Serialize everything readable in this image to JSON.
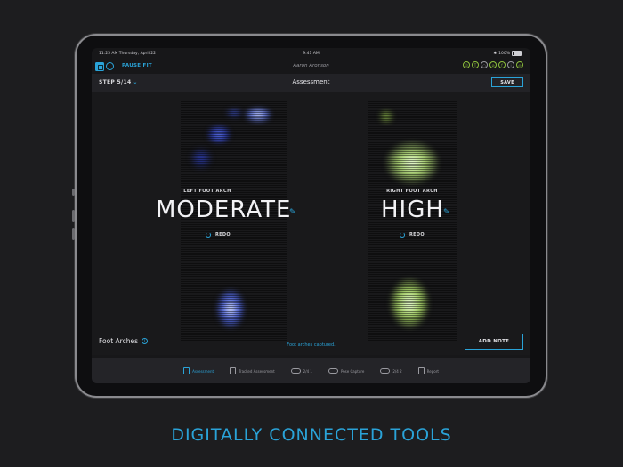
{
  "status_bar": {
    "time_date": "11:25 AM   Thursday, April 22",
    "center_time": "9:41 AM",
    "battery": "100%"
  },
  "top_bar": {
    "pause_label": "PAUSE FIT",
    "athlete_name": "Aaron Aronson",
    "tool_icons": [
      "tool-1",
      "tool-2",
      "tool-3",
      "tool-4",
      "tool-5",
      "tool-6",
      "tool-7"
    ]
  },
  "header": {
    "step_label": "STEP 5/14",
    "title": "Assessment",
    "save_label": "SAVE"
  },
  "left_foot": {
    "label": "LEFT FOOT ARCH",
    "value": "MODERATE",
    "redo_label": "REDO"
  },
  "right_foot": {
    "label": "RIGHT FOOT ARCH",
    "value": "HIGH",
    "redo_label": "REDO"
  },
  "footer": {
    "section_label": "Foot Arches",
    "status_message": "Foot arches captured.",
    "add_note_label": "ADD NOTE"
  },
  "bottom_nav": [
    {
      "label": "Assessment",
      "active": true
    },
    {
      "label": "Tracked Assessment",
      "active": false
    },
    {
      "label": "2/4 1",
      "active": false
    },
    {
      "label": "Pose Capture",
      "active": false
    },
    {
      "label": "2/4 2",
      "active": false
    },
    {
      "label": "Report",
      "active": false
    }
  ],
  "tagline": "DIGITALLY CONNECTED TOOLS",
  "colors": {
    "accent": "#2aa3d8",
    "left_heat": "#3a4fc8",
    "right_heat": "#8fbf4a",
    "background": "#1d1d1f"
  }
}
